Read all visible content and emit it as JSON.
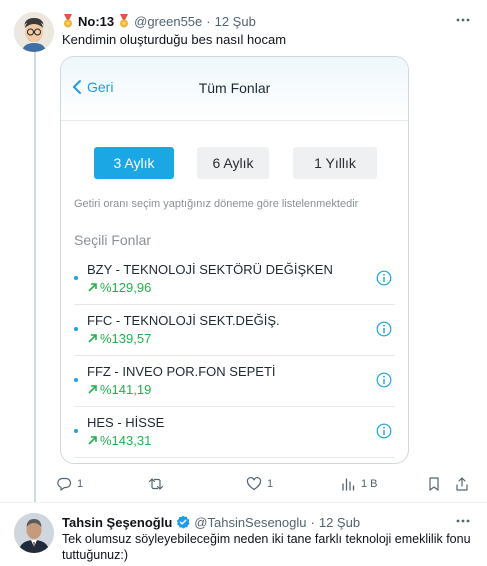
{
  "tweet1": {
    "name": "No:13",
    "handle": "@green55e",
    "dot": "·",
    "date": "12 Şub",
    "text": "Kendimin oluşturduğu bes nasıl hocam",
    "actions": {
      "replies": "1",
      "retweets": "",
      "likes": "1",
      "views": "1 B"
    }
  },
  "card": {
    "back_label": "Geri",
    "title": "Tüm Fonlar",
    "periods": [
      "3 Aylık",
      "6 Aylık",
      "1 Yıllık"
    ],
    "selected_period": "3 Aylık",
    "note": "Getiri oranı seçim yaptığınız döneme göre listelenmektedir",
    "section_title": "Seçili Fonlar",
    "funds": [
      {
        "name": "BZY - TEKNOLOJİ SEKTÖRÜ DEĞİŞKEN",
        "return": "%129,96"
      },
      {
        "name": "FFC - TEKNOLOJİ SEKT.DEĞİŞ.",
        "return": "%139,57"
      },
      {
        "name": "FFZ - INVEO POR.FON SEPETİ",
        "return": "%141,19"
      },
      {
        "name": "HES - HİSSE",
        "return": "%143,31"
      }
    ],
    "colors": {
      "accent": "#1ba6e4",
      "positive": "#22b24c"
    }
  },
  "tweet2": {
    "name": "Tahsin Şeşenoğlu",
    "handle": "@TahsinSesenoglu",
    "dot": "·",
    "date": "12 Şub",
    "text": "Tek olumsuz söyleyebileceğim neden iki tane farklı teknoloji emeklilik fonu tuttuğunuz:)"
  },
  "icons": {
    "more": "more-horizontal-icon",
    "reply": "reply-icon",
    "retweet": "retweet-icon",
    "like": "heart-icon",
    "views": "bar-chart-icon",
    "bookmark": "bookmark-icon",
    "share": "share-icon",
    "verified": "verified-badge-icon",
    "medal": "medal-icon",
    "info": "info-icon",
    "arrow_up": "arrow-up-right-icon",
    "back": "chevron-left-icon"
  },
  "colors": {
    "twitter_blue": "#1d9bf0",
    "muted": "#536471"
  }
}
